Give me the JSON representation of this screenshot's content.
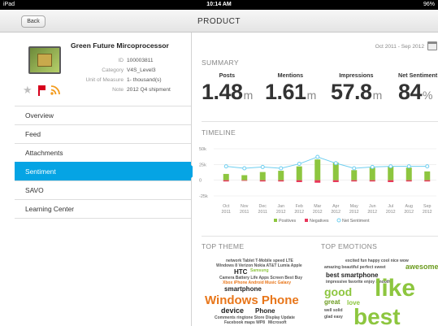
{
  "status_bar": {
    "device": "iPad",
    "time": "10:14 AM",
    "battery": "96%"
  },
  "nav": {
    "back_label": "Back",
    "title": "PRODUCT"
  },
  "product": {
    "name": "Green Future Mircoprocessor",
    "fields": [
      {
        "key": "ID",
        "value": "100003811"
      },
      {
        "key": "Category",
        "value": "V4S_Level3"
      },
      {
        "key": "Unit of Measure",
        "value": "1- thousand(s)"
      },
      {
        "key": "Note",
        "value": "2012 Q4 shipment"
      }
    ],
    "icons": [
      "star-icon",
      "flag-icon",
      "rss-icon"
    ]
  },
  "menu": [
    {
      "label": "Overview",
      "active": false
    },
    {
      "label": "Feed",
      "active": false
    },
    {
      "label": "Attachments",
      "active": false
    },
    {
      "label": "Sentiment",
      "active": true
    },
    {
      "label": "SAVO",
      "active": false
    },
    {
      "label": "Learning Center",
      "active": false
    }
  ],
  "date_range": "Oct 2011 - Sep 2012",
  "summary": {
    "title": "SUMMARY",
    "metrics": [
      {
        "label": "Posts",
        "value": "1.48",
        "unit": "m"
      },
      {
        "label": "Mentions",
        "value": "1.61",
        "unit": "m"
      },
      {
        "label": "Impressions",
        "value": "57.8",
        "unit": "m"
      },
      {
        "label": "Net Sentiment",
        "value": "84",
        "unit": "%"
      }
    ]
  },
  "timeline": {
    "title": "TIMELINE"
  },
  "chart_data": {
    "type": "bar",
    "categories": [
      "Oct 2011",
      "Nov 2011",
      "Dec 2011",
      "Jan 2012",
      "Feb 2012",
      "Mar 2012",
      "Apr 2012",
      "May 2012",
      "Jun 2012",
      "Jul 2012",
      "Aug 2012",
      "Sep 2012"
    ],
    "tick_top": [
      "Oct",
      "Nov",
      "Dec",
      "Jan",
      "Feb",
      "Mar",
      "Apr",
      "May",
      "Jun",
      "Jul",
      "Aug",
      "Sep"
    ],
    "tick_bottom": [
      "2011",
      "2011",
      "2011",
      "2012",
      "2012",
      "2012",
      "2012",
      "2012",
      "2012",
      "2012",
      "2012",
      "2012"
    ],
    "series": [
      {
        "name": "Positives",
        "values": [
          10,
          8,
          13,
          15,
          22,
          33,
          28,
          16,
          20,
          22,
          20,
          14
        ]
      },
      {
        "name": "Negatives",
        "values": [
          -2,
          -1,
          -2,
          -2,
          -3,
          -4,
          -3,
          -2,
          -2,
          -3,
          -2,
          -2
        ]
      },
      {
        "name": "Net Sentiment",
        "values": [
          22,
          19,
          21,
          19,
          26,
          37,
          27,
          19,
          21,
          22,
          22,
          22
        ]
      }
    ],
    "yticks": [
      "50k",
      "25k",
      "0",
      "-25k"
    ],
    "ytick_values": [
      50,
      25,
      0,
      -25
    ],
    "ylim": [
      -25,
      50
    ],
    "grid": true,
    "legend_position": "bottom",
    "colors": {
      "positives": "#8dc63f",
      "negatives": "#e8365a",
      "net": "#6fcff0"
    }
  },
  "top_theme": {
    "title": "TOP THEME",
    "words": [
      {
        "text": "Windows Phone",
        "color": "#e8761a"
      },
      {
        "text": "device",
        "color": "#222222"
      },
      {
        "text": "Phone",
        "color": "#222222"
      },
      {
        "text": "smartphone",
        "color": "#222222"
      },
      {
        "text": "HTC",
        "color": "#222222"
      },
      {
        "text": "Samsung",
        "color": "#8dc63f"
      },
      {
        "text": "Nokia Lumia",
        "color": "#222222"
      },
      {
        "text": "Microsoft",
        "color": "#222222"
      }
    ]
  },
  "top_emotions": {
    "title": "TOP EMOTIONS",
    "words": [
      {
        "text": "like",
        "color": "#8dc63f"
      },
      {
        "text": "best",
        "color": "#8dc63f"
      },
      {
        "text": "good",
        "color": "#8dc63f"
      },
      {
        "text": "awesome",
        "color": "#6b9b1e"
      },
      {
        "text": "best smartphone",
        "color": "#222222"
      },
      {
        "text": "love",
        "color": "#8dc63f"
      },
      {
        "text": "great",
        "color": "#6b9b1e"
      }
    ]
  }
}
